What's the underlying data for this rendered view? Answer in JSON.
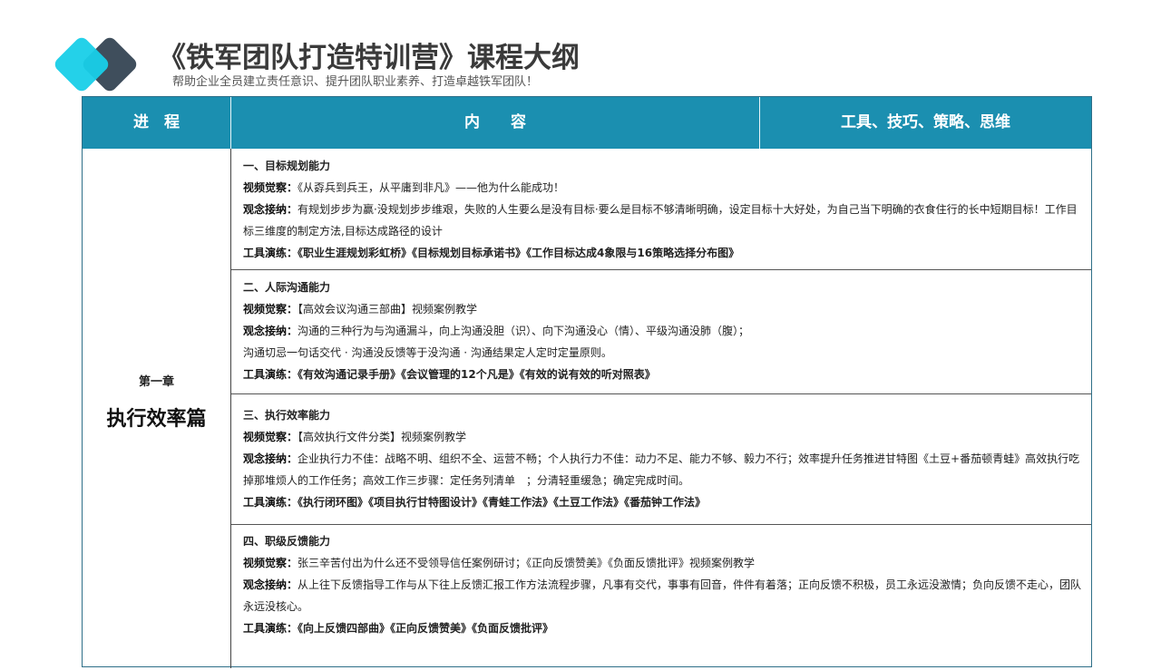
{
  "header": {
    "title": "《铁军团队打造特训营》课程大纲",
    "subtitle": "帮助企业全员建立责任意识、提升团队职业素养、打造卓越铁军团队！"
  },
  "table": {
    "columns": [
      "进　程",
      "内　　容",
      "工具、技巧、策略、思维"
    ],
    "chapter": {
      "number": "第一章",
      "title": "执行效率篇"
    },
    "sections": [
      {
        "heading": "一、目标规划能力",
        "video_label": "视频觉察：",
        "video": "《从孬兵到兵王，从平庸到非凡》——他为什么能成功！",
        "concept_label": "观念接纳：",
        "concept": "有规划步步为赢·没规划步步维艰，失败的人生要么是没有目标·要么是目标不够清晰明确，设定目标十大好处，为自己当下明确的衣食住行的长中短期目标！工作目标三维度的制定方法,目标达成路径的设计",
        "tools_label": "工具演练：",
        "tools": "《职业生涯规划彩虹桥》《目标规划目标承诺书》《工作目标达成4象限与16策略选择分布图》"
      },
      {
        "heading": "二、人际沟通能力",
        "video_label": "视频觉察：",
        "video": "【高效会议沟通三部曲】视频案例教学",
        "concept_label": "观念接纳：",
        "concept": "沟通的三种行为与沟通漏斗，向上沟通没胆（识）、向下沟通没心（情）、平级沟通没肺（腹）；",
        "concept2": "沟通切忌一句话交代 · 沟通没反馈等于没沟通 · 沟通结果定人定时定量原则。",
        "tools_label": "工具演练：",
        "tools": "《有效沟通记录手册》《会议管理的12个凡是》《有效的说有效的听对照表》"
      },
      {
        "heading": "三、执行效率能力",
        "video_label": "视频觉察：",
        "video": "【高效执行文件分类】视频案例教学",
        "concept_label": "观念接纳：",
        "concept": "企业执行力不佳：战略不明、组织不全、运营不畅；个人执行力不佳：动力不足、能力不够、毅力不行；效率提升任务推进甘特图《土豆+番茄顿青蛙》高效执行吃掉那堆烦人的工作任务；高效工作三步骤：定任务列清单　；分清轻重缓急；确定完成时间。",
        "tools_label": "工具演练：",
        "tools": "《执行闭环图》《项目执行甘特图设计》《青蛙工作法》《土豆工作法》《番茄钟工作法》"
      },
      {
        "heading": "四、职级反馈能力",
        "video_label": "视频觉察：",
        "video": "张三辛苦付出为什么还不受领导信任案例研讨；《正向反馈赞美》《负面反馈批评》视频案例教学",
        "concept_label": "观念接纳：",
        "concept": "从上往下反馈指导工作与从下往上反馈汇报工作方法流程步骤，凡事有交代，事事有回音，件件有着落；正向反馈不积极，员工永远没激情；负向反馈不走心，团队永远没核心。",
        "tools_label": "工具演练：",
        "tools": "《向上反馈四部曲》《正向反馈赞美》《负面反馈批评》"
      }
    ]
  }
}
